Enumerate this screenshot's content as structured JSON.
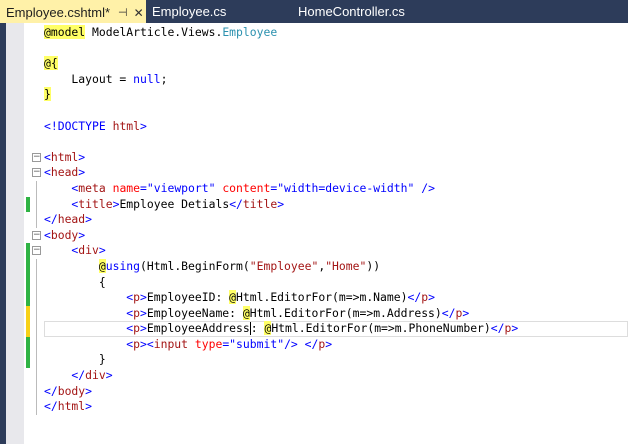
{
  "tabs": [
    {
      "label": "Employee.cshtml*",
      "active": true
    },
    {
      "label": "Employee.cs",
      "active": false
    },
    {
      "label": "HomeController.cs",
      "active": false
    }
  ],
  "tab_icons": {
    "pin": "pin-icon",
    "close": "close-icon"
  },
  "colors": {
    "tabbar": "#2d3c5a",
    "active_tab": "#fff1a8",
    "changed_saved": "#2fb344",
    "changed_unsaved": "#f7d117"
  },
  "lines": [
    {
      "tokens": [
        [
          "@model",
          "razor"
        ],
        [
          " ModelArticle.Views.",
          "txt"
        ],
        [
          "Employee",
          "type"
        ]
      ]
    },
    {
      "tokens": []
    },
    {
      "tokens": [
        [
          "@{",
          "razor"
        ]
      ]
    },
    {
      "tokens": [
        [
          "    Layout = ",
          "txt"
        ],
        [
          "null",
          "kw"
        ],
        [
          ";",
          "txt"
        ]
      ]
    },
    {
      "tokens": [
        [
          "}",
          "razor"
        ]
      ]
    },
    {
      "tokens": []
    },
    {
      "tokens": [
        [
          "<!",
          "br"
        ],
        [
          "DOCTYPE",
          "br"
        ],
        [
          " html",
          "tag"
        ],
        [
          ">",
          "br"
        ]
      ]
    },
    {
      "tokens": []
    },
    {
      "fold": "open",
      "tokens": [
        [
          "<",
          "br"
        ],
        [
          "html",
          "tag"
        ],
        [
          ">",
          "br"
        ]
      ]
    },
    {
      "fold": "open",
      "tokens": [
        [
          "<",
          "br"
        ],
        [
          "head",
          "tag"
        ],
        [
          ">",
          "br"
        ]
      ]
    },
    {
      "v": 1,
      "tokens": [
        [
          "    <",
          "br"
        ],
        [
          "meta",
          "tag"
        ],
        [
          " name",
          "attr"
        ],
        [
          "=\"viewport\"",
          "val"
        ],
        [
          " content",
          "attr"
        ],
        [
          "=\"width=device-width\"",
          "val"
        ],
        [
          " />",
          "br"
        ]
      ]
    },
    {
      "v": 1,
      "chg": "g",
      "tokens": [
        [
          "    <",
          "br"
        ],
        [
          "title",
          "tag"
        ],
        [
          ">",
          "br"
        ],
        [
          "Employee Detials",
          "txt"
        ],
        [
          "</",
          "br"
        ],
        [
          "title",
          "tag"
        ],
        [
          ">",
          "br"
        ]
      ]
    },
    {
      "v": 1,
      "tokens": [
        [
          "</",
          "br"
        ],
        [
          "head",
          "tag"
        ],
        [
          ">",
          "br"
        ]
      ]
    },
    {
      "fold": "open",
      "tokens": [
        [
          "<",
          "br"
        ],
        [
          "body",
          "tag"
        ],
        [
          ">",
          "br"
        ]
      ]
    },
    {
      "fold": "open",
      "chg": "g",
      "tokens": [
        [
          "    <",
          "br"
        ],
        [
          "div",
          "tag"
        ],
        [
          ">",
          "br"
        ]
      ]
    },
    {
      "v": 1,
      "chg": "g",
      "tokens": [
        [
          "        ",
          "txt"
        ],
        [
          "@",
          "razor"
        ],
        [
          "using",
          "kw"
        ],
        [
          "(Html.BeginForm(",
          "txt"
        ],
        [
          "\"Employee\"",
          "str"
        ],
        [
          ",",
          "txt"
        ],
        [
          "\"Home\"",
          "str"
        ],
        [
          "))",
          "txt"
        ]
      ]
    },
    {
      "v": 1,
      "chg": "g",
      "tokens": [
        [
          "        {",
          "txt"
        ]
      ]
    },
    {
      "v": 1,
      "chg": "g",
      "tokens": [
        [
          "            <",
          "br"
        ],
        [
          "p",
          "tag"
        ],
        [
          ">",
          "br"
        ],
        [
          "EmployeeID: ",
          "txt"
        ],
        [
          "@",
          "razor"
        ],
        [
          "Html.EditorFor(m=>m.Name)",
          "txt"
        ],
        [
          "</",
          "br"
        ],
        [
          "p",
          "tag"
        ],
        [
          ">",
          "br"
        ]
      ]
    },
    {
      "v": 1,
      "chg": "y",
      "tokens": [
        [
          "            <",
          "br"
        ],
        [
          "p",
          "tag"
        ],
        [
          ">",
          "br"
        ],
        [
          "EmployeeName: ",
          "txt"
        ],
        [
          "@",
          "razor"
        ],
        [
          "Html.EditorFor(m=>m.Address)",
          "txt"
        ],
        [
          "</",
          "br"
        ],
        [
          "p",
          "tag"
        ],
        [
          ">",
          "br"
        ]
      ]
    },
    {
      "v": 1,
      "chg": "y",
      "current": true,
      "caret_after": 4,
      "tokens": [
        [
          "            <",
          "br"
        ],
        [
          "p",
          "tag"
        ],
        [
          ">",
          "br"
        ],
        [
          "EmployeeAddress",
          "txt"
        ],
        [
          ": ",
          "txt"
        ],
        [
          "@",
          "razor"
        ],
        [
          "Html.EditorFor(m=>m.PhoneNumber)",
          "txt"
        ],
        [
          "</",
          "br"
        ],
        [
          "p",
          "tag"
        ],
        [
          ">",
          "br"
        ]
      ]
    },
    {
      "v": 1,
      "chg": "g",
      "tokens": [
        [
          "            <",
          "br"
        ],
        [
          "p",
          "tag"
        ],
        [
          "><",
          "br"
        ],
        [
          "input",
          "tag"
        ],
        [
          " type",
          "attr"
        ],
        [
          "=\"submit\"",
          "val"
        ],
        [
          "/> </",
          "br"
        ],
        [
          "p",
          "tag"
        ],
        [
          ">",
          "br"
        ]
      ]
    },
    {
      "v": 1,
      "chg": "g",
      "tokens": [
        [
          "        }",
          "txt"
        ]
      ]
    },
    {
      "v": 1,
      "tokens": [
        [
          "    </",
          "br"
        ],
        [
          "div",
          "tag"
        ],
        [
          ">",
          "br"
        ]
      ]
    },
    {
      "v": 1,
      "tokens": [
        [
          "</",
          "br"
        ],
        [
          "body",
          "tag"
        ],
        [
          ">",
          "br"
        ]
      ]
    },
    {
      "v": 1,
      "tokens": [
        [
          "</",
          "br"
        ],
        [
          "html",
          "tag"
        ],
        [
          ">",
          "br"
        ]
      ]
    }
  ]
}
